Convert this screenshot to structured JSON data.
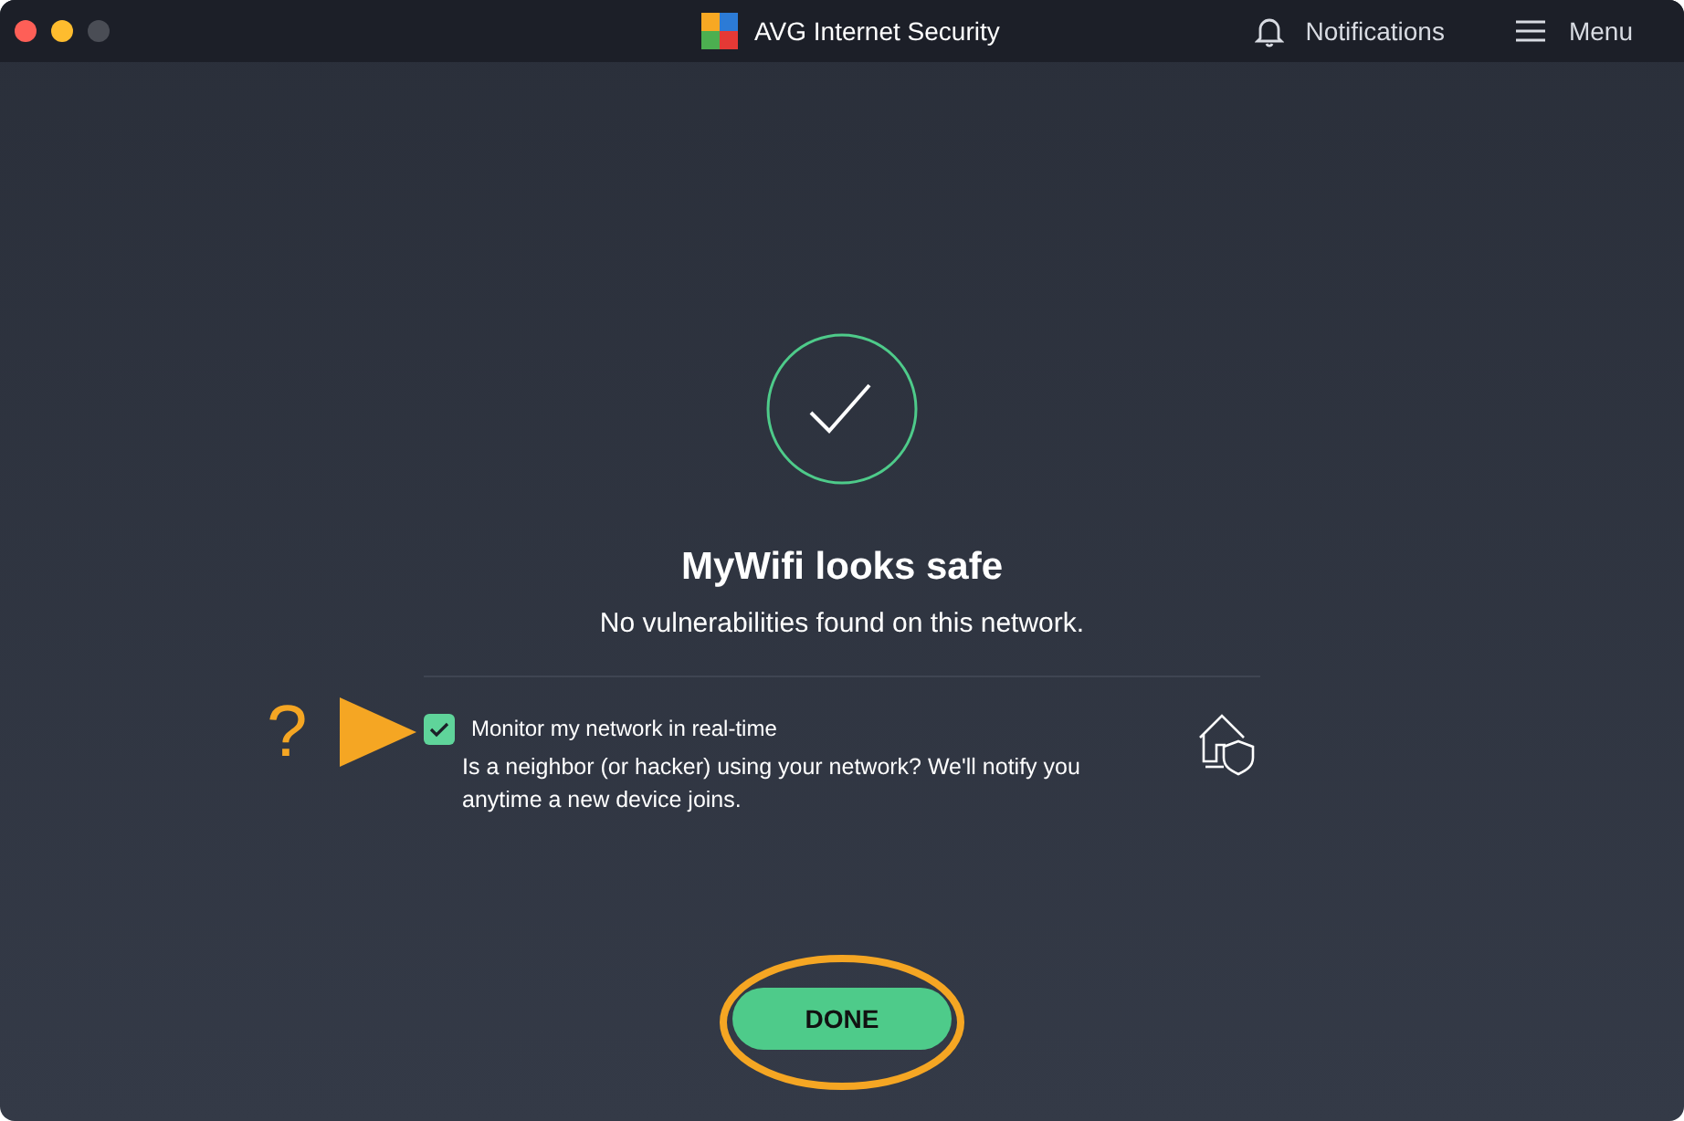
{
  "window": {
    "title": "AVG Internet Security"
  },
  "header": {
    "notifications": "Notifications",
    "menu": "Menu"
  },
  "result": {
    "title": "MyWifi looks safe",
    "subtitle": "No vulnerabilities found on this network."
  },
  "option": {
    "label": "Monitor my network in real-time",
    "checked": true,
    "description": "Is a neighbor (or hacker) using your network? We'll notify you anytime a new device joins."
  },
  "annotation": {
    "mark": "?"
  },
  "done_button": "DONE"
}
